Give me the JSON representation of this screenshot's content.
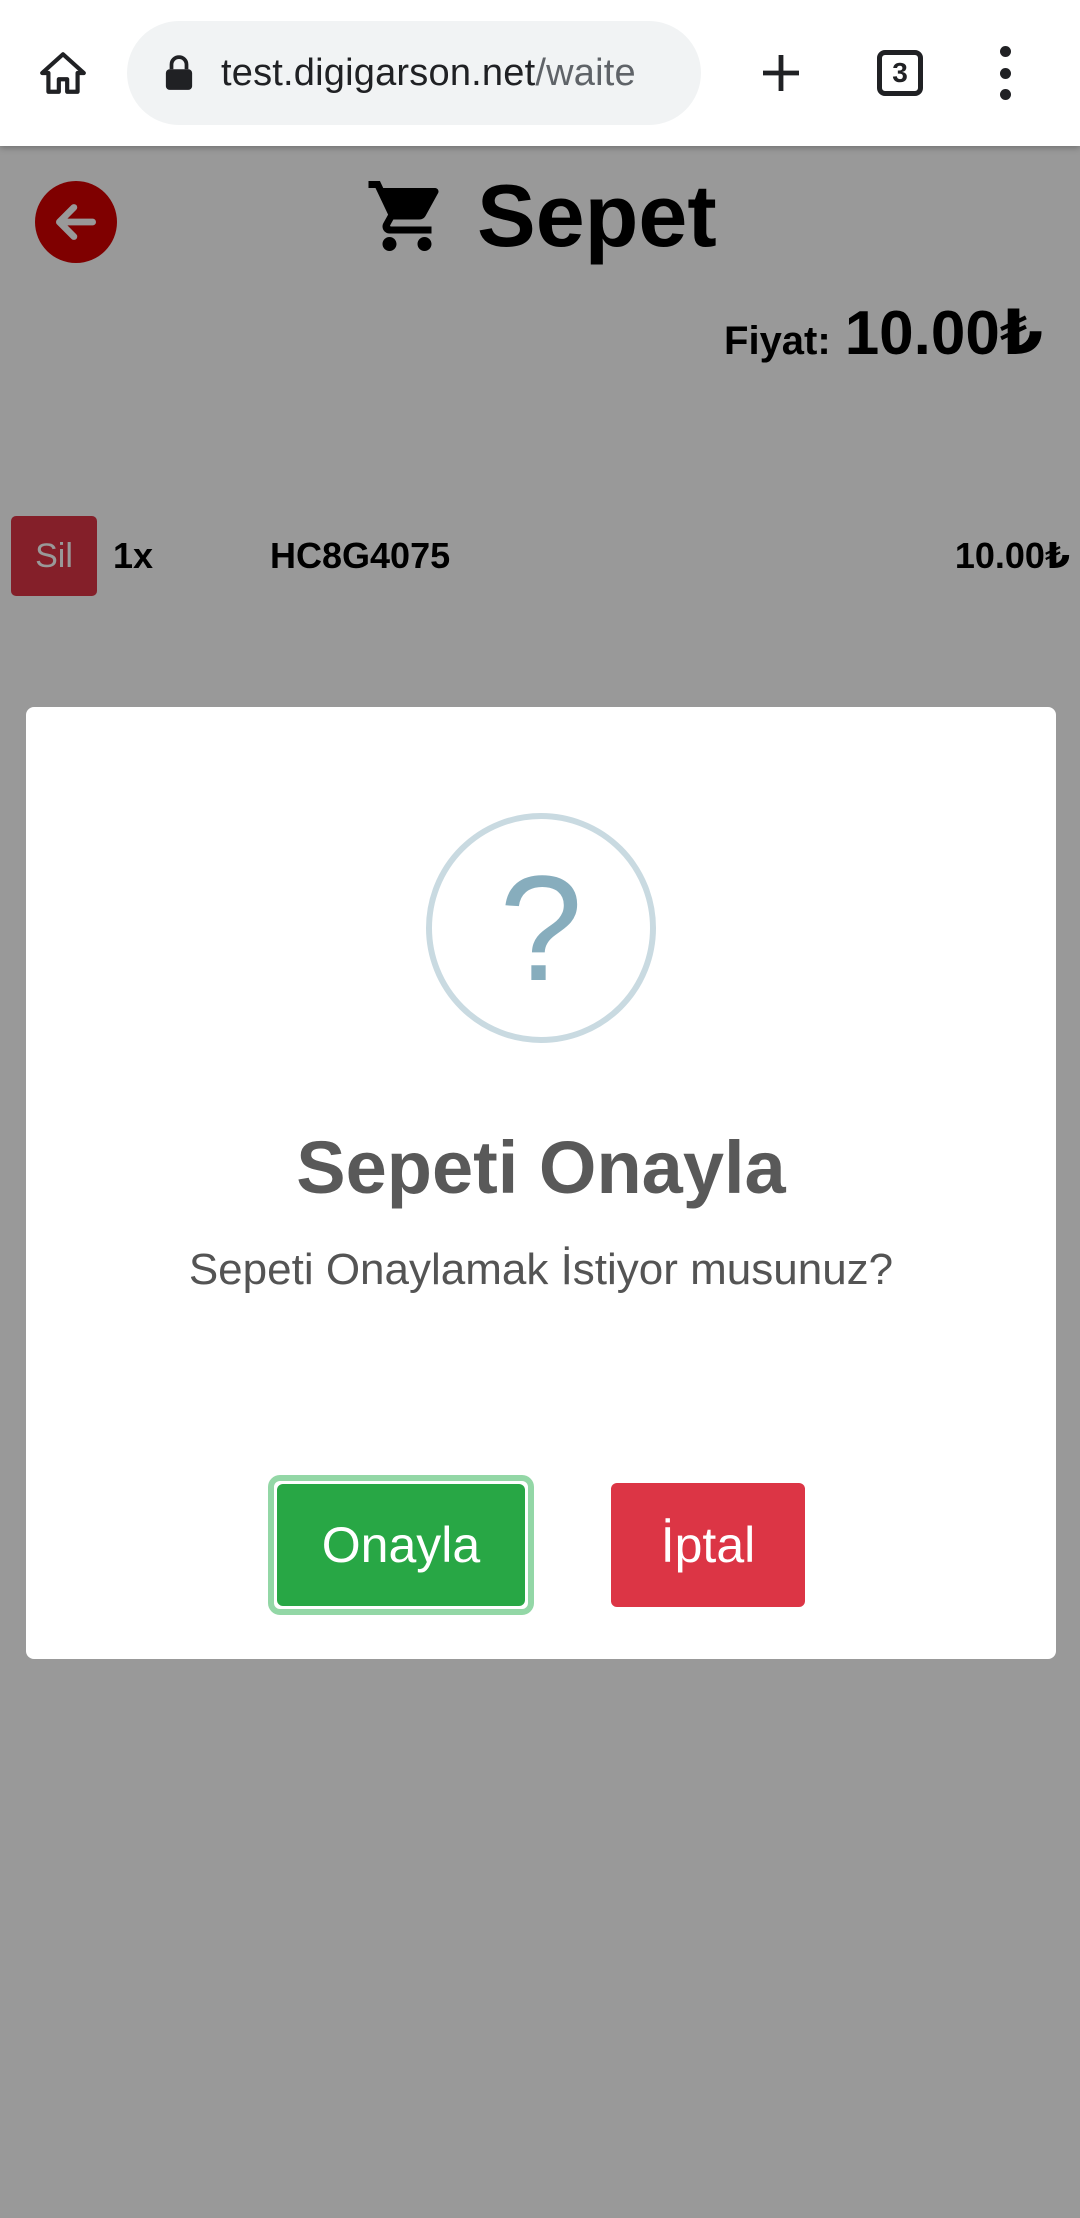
{
  "browser": {
    "url_host": "test.digigarson.net",
    "url_path": "/waite",
    "tab_count": "3",
    "icons": {
      "home": "home-icon",
      "lock": "lock-icon",
      "new_tab": "plus-icon",
      "menu": "more-vert-icon"
    }
  },
  "page": {
    "back_icon": "arrow-left-icon",
    "cart_icon": "cart-icon",
    "title": "Sepet",
    "price_label": "Fiyat:",
    "price_value": "10.00₺",
    "items": [
      {
        "delete_label": "Sil",
        "quantity": "1x",
        "name": "HC8G4075",
        "price": "10.00₺"
      }
    ]
  },
  "modal": {
    "icon": "question-icon",
    "icon_glyph": "?",
    "title": "Sepeti Onayla",
    "text": "Sepeti Onaylamak İstiyor musunuz?",
    "confirm_label": "Onayla",
    "cancel_label": "İptal"
  },
  "colors": {
    "back_button": "#d40000",
    "delete_button": "#dc3545",
    "confirm_button": "#28a745",
    "cancel_button": "#dc3545",
    "question_icon": "#87adbd"
  }
}
